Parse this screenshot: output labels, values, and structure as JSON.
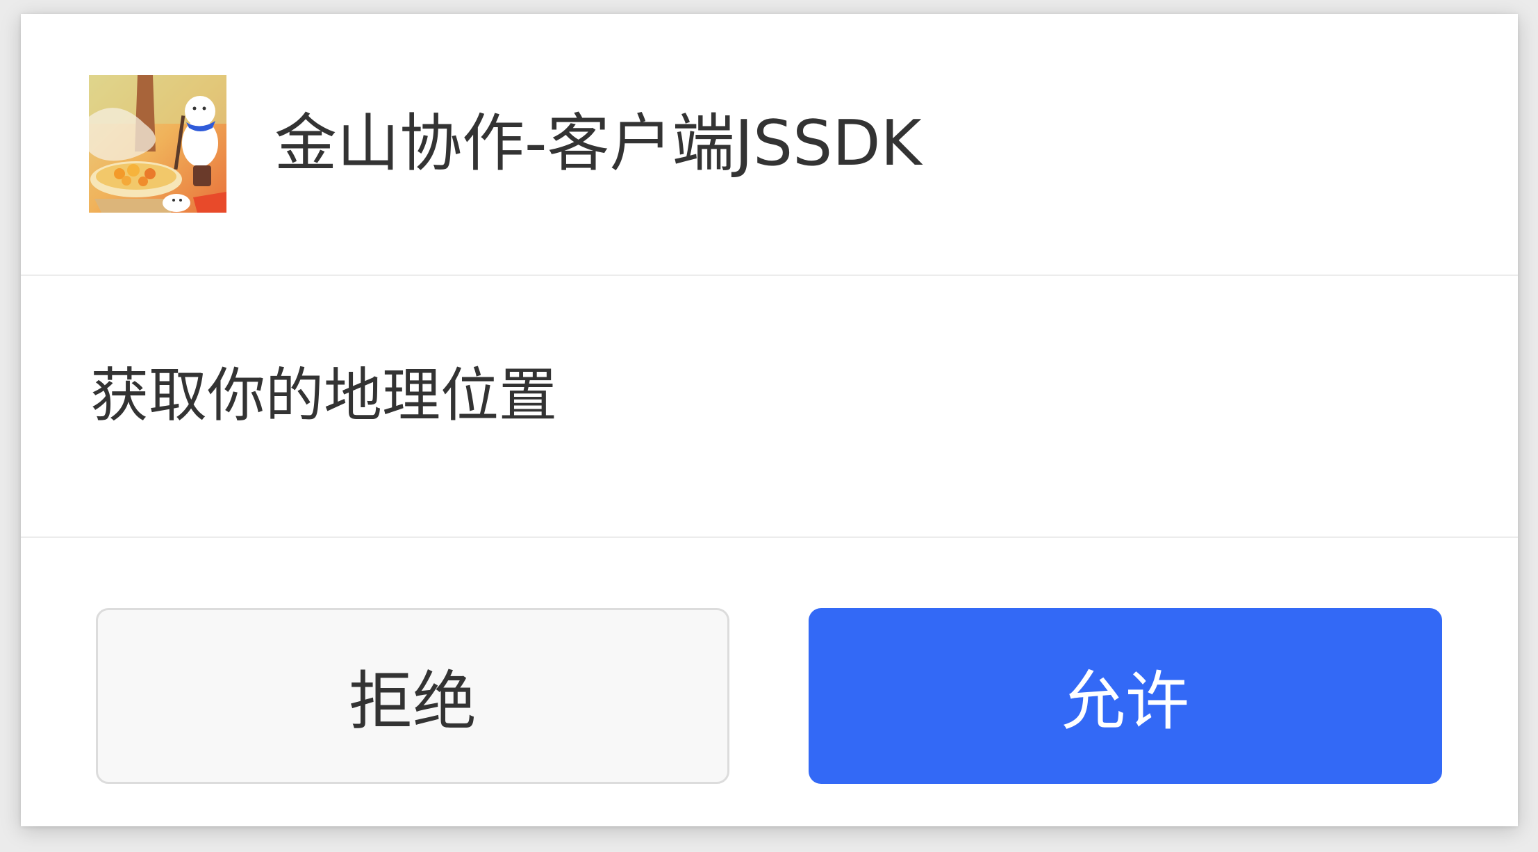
{
  "dialog": {
    "app_title": "金山协作-客户端JSSDK",
    "app_icon": "app-illustration-icon",
    "permission_text": "获取你的地理位置",
    "deny_label": "拒绝",
    "allow_label": "允许"
  },
  "colors": {
    "allow_button": "#3369f6",
    "deny_button": "#f8f8f8",
    "text": "#333333"
  }
}
